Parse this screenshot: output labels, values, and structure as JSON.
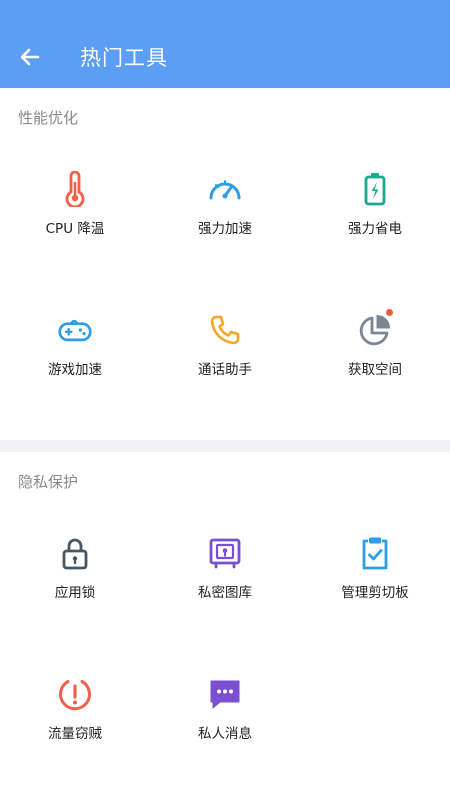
{
  "header": {
    "title": "热门工具"
  },
  "sections": [
    {
      "title": "性能优化",
      "items": [
        {
          "label": "CPU 降温",
          "icon": "thermometer-icon",
          "color": "#f0604a"
        },
        {
          "label": "强力加速",
          "icon": "speedometer-icon",
          "color": "#2c9de6"
        },
        {
          "label": "强力省电",
          "icon": "battery-icon",
          "color": "#1aaa92"
        },
        {
          "label": "游戏加速",
          "icon": "gamepad-icon",
          "color": "#2c9de6"
        },
        {
          "label": "通话助手",
          "icon": "phone-icon",
          "color": "#f5a623"
        },
        {
          "label": "获取空间",
          "icon": "pie-chart-icon",
          "color": "#7d8696",
          "badge": true
        }
      ]
    },
    {
      "title": "隐私保护",
      "items": [
        {
          "label": "应用锁",
          "icon": "lock-icon",
          "color": "#4a5666"
        },
        {
          "label": "私密图库",
          "icon": "safe-icon",
          "color": "#7b4fd0"
        },
        {
          "label": "管理剪切板",
          "icon": "clipboard-check-icon",
          "color": "#2c9de6"
        },
        {
          "label": "流量窃贼",
          "icon": "alert-circle-icon",
          "color": "#f0604a"
        },
        {
          "label": "私人消息",
          "icon": "message-icon",
          "color": "#7b4fd0"
        }
      ]
    }
  ],
  "colors": {
    "app_bar": "#5b9ef3",
    "badge": "#f25a3c"
  }
}
